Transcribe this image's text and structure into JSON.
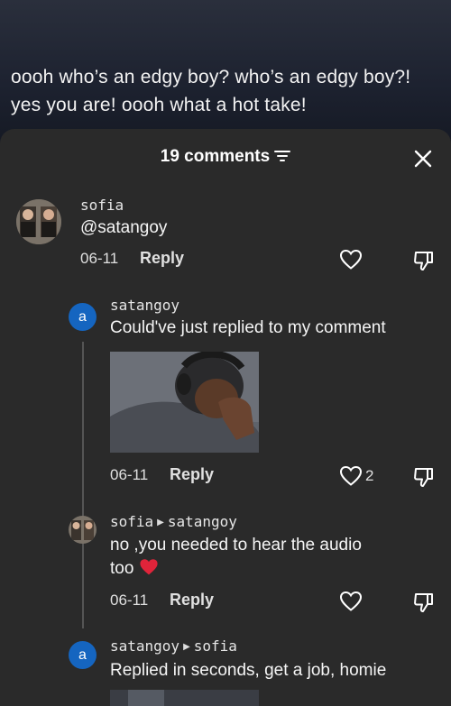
{
  "background": {
    "caption": "oooh who’s an edgy boy? who’s an edgy boy?! yes you are! oooh what a hot take!"
  },
  "sheet": {
    "title": "19 comments"
  },
  "comments": [
    {
      "username": "sofia",
      "text": "@satangoy",
      "date": "06-11",
      "reply_label": "Reply"
    },
    {
      "username": "satangoy",
      "avatar_letter": "a",
      "text": "Could've just replied to my comment",
      "date": "06-11",
      "reply_label": "Reply",
      "likes": "2"
    },
    {
      "username": "sofia",
      "reply_to": "satangoy",
      "text_line1": "no ,you needed to hear the audio",
      "text_line2": "too",
      "emoji": "❤️",
      "date": "06-11",
      "reply_label": "Reply"
    },
    {
      "username": "satangoy",
      "avatar_letter": "a",
      "reply_to": "sofia",
      "text": "Replied in seconds, get a job, homie"
    }
  ],
  "colors": {
    "sheet_bg": "#2a2a2a",
    "avatar_blue": "#1565c0",
    "heart_red": "#e0243a"
  }
}
